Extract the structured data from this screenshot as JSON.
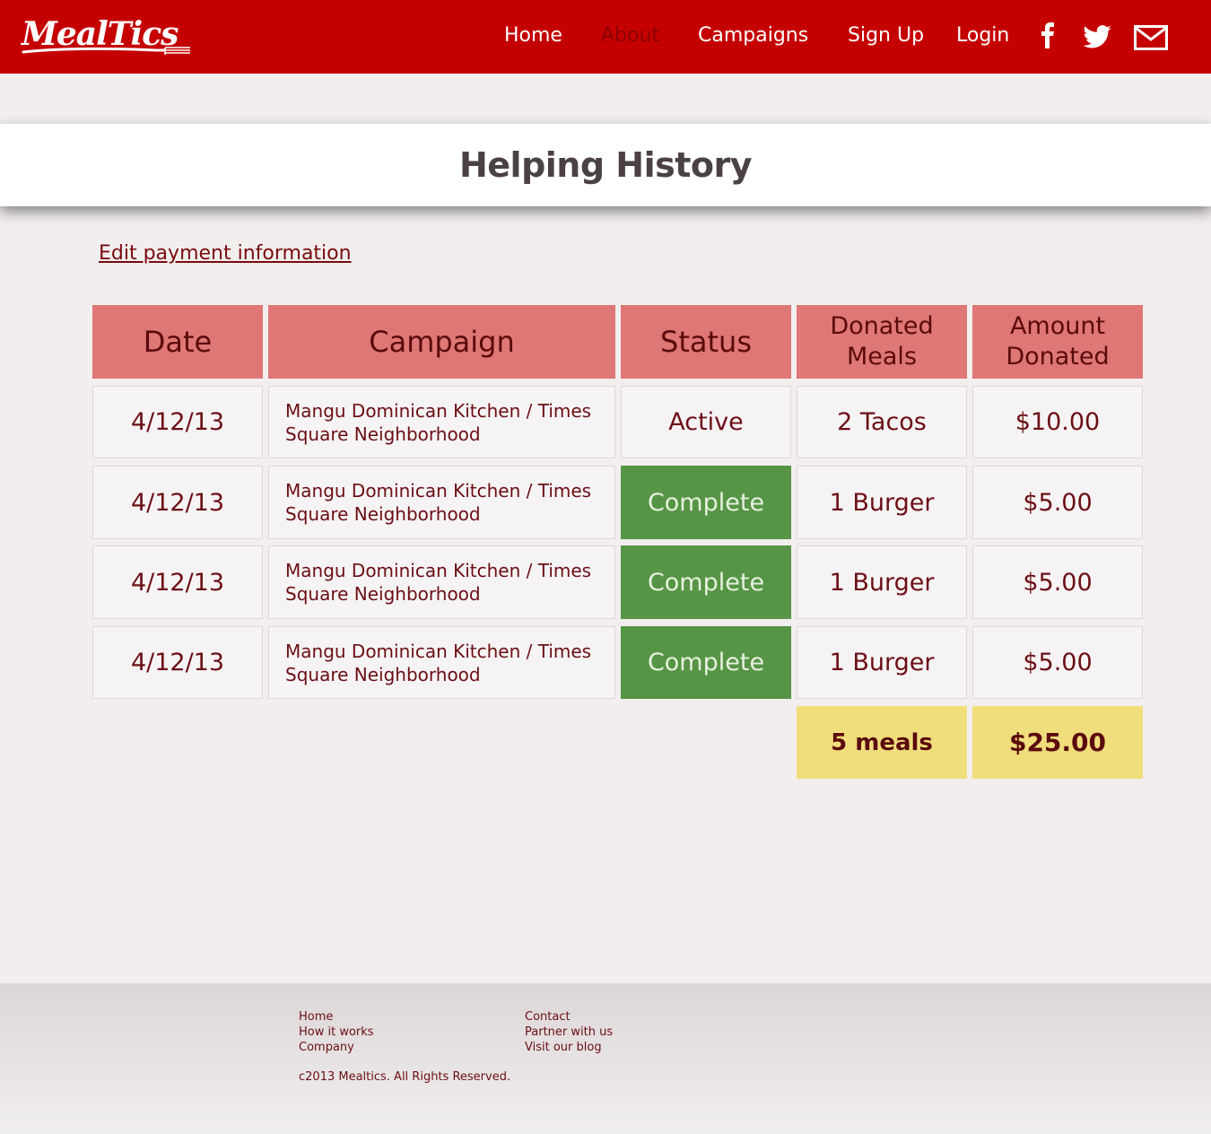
{
  "header": {
    "logo_text": "MealTics",
    "nav": [
      {
        "label": "Home"
      },
      {
        "label": "About"
      },
      {
        "label": "Campaigns"
      },
      {
        "label": "Sign Up"
      },
      {
        "label": "Login"
      }
    ],
    "social_icons": [
      "facebook-icon",
      "twitter-icon",
      "mail-icon"
    ],
    "brand_color": "#c50000",
    "active_nav_color": "#8c0000"
  },
  "page_title": "Helping History",
  "edit_payment_link": "Edit payment information",
  "table": {
    "columns": [
      "Date",
      "Campaign",
      "Status",
      "Donated Meals",
      "Amount Donated"
    ],
    "rows": [
      {
        "date": "4/12/13",
        "campaign": "Mangu Dominican Kitchen / Times Square Neighborhood",
        "status": "Active",
        "meals": "2 Tacos",
        "amount": "$10.00"
      },
      {
        "date": "4/12/13",
        "campaign": "Mangu Dominican Kitchen / Times Square Neighborhood",
        "status": "Complete",
        "meals": "1 Burger",
        "amount": "$5.00"
      },
      {
        "date": "4/12/13",
        "campaign": "Mangu Dominican Kitchen / Times Square Neighborhood",
        "status": "Complete",
        "meals": "1 Burger",
        "amount": "$5.00"
      },
      {
        "date": "4/12/13",
        "campaign": "Mangu Dominican Kitchen / Times Square Neighborhood",
        "status": "Complete",
        "meals": "1 Burger",
        "amount": "$5.00"
      }
    ],
    "totals": {
      "meals": "5 meals",
      "amount": "$25.00"
    },
    "colors": {
      "header": "#de7775",
      "complete": "#569545",
      "totals": "#f0dd7b"
    }
  },
  "footer": {
    "col1": [
      "Home",
      "How it works",
      "Company"
    ],
    "col2": [
      "Contact",
      "Partner with us",
      "Visit our blog"
    ],
    "copyright": "c2013 Mealtics. All Rights Reserved."
  }
}
